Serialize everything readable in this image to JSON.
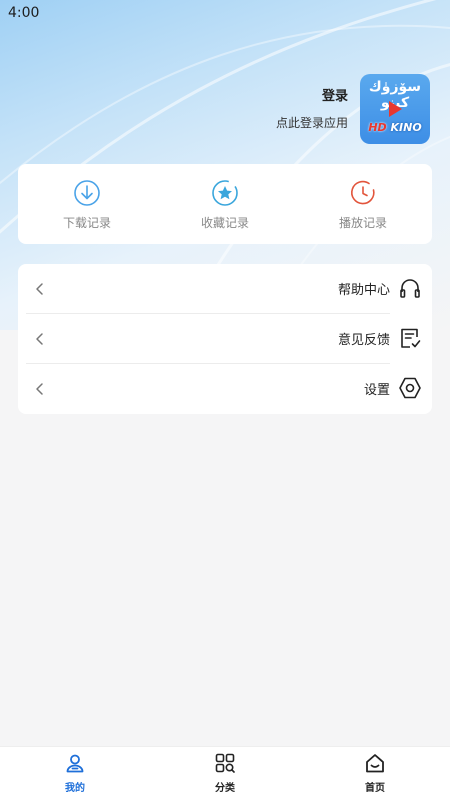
{
  "status_bar": {
    "time": "4:00"
  },
  "profile": {
    "login_title": "登录",
    "login_subtitle": "点此登录应用",
    "logo_arabic": "سۆزۈك كىنو",
    "logo_text_hd": "HD",
    "logo_text_kino": "KINO"
  },
  "records": [
    {
      "label": "下载记录",
      "icon": "download-icon"
    },
    {
      "label": "收藏记录",
      "icon": "star-icon"
    },
    {
      "label": "播放记录",
      "icon": "clock-icon"
    }
  ],
  "menu": [
    {
      "label": "帮助中心",
      "icon": "headset-icon"
    },
    {
      "label": "意见反馈",
      "icon": "feedback-icon"
    },
    {
      "label": "设置",
      "icon": "settings-hexagon-icon"
    }
  ],
  "bottom_nav": [
    {
      "label": "我的",
      "icon": "user-icon",
      "active": true
    },
    {
      "label": "分类",
      "icon": "grid-search-icon",
      "active": false
    },
    {
      "label": "首页",
      "icon": "home-icon",
      "active": false
    }
  ],
  "colors": {
    "accent": "#1e6fd9",
    "download_icon": "#4aa3e8",
    "star_icon": "#3aa6dc",
    "clock_icon": "#e2553c"
  }
}
